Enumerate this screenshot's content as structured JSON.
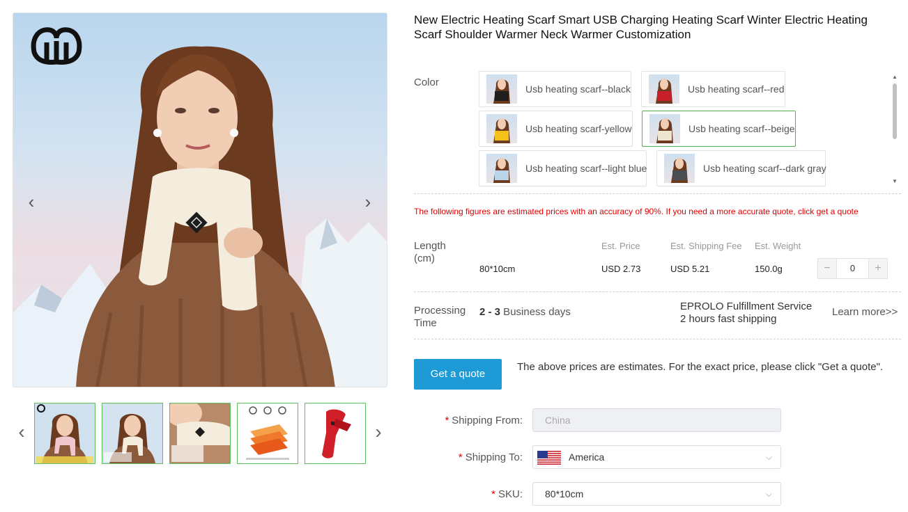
{
  "product": {
    "title": "New Electric Heating Scarf Smart USB Charging Heating Scarf Winter Electric Heating Scarf Shoulder Warmer Neck Warmer Customization"
  },
  "gallery": {
    "prev_arrow": "‹",
    "next_arrow": "›",
    "thumb_prev": "‹",
    "thumb_next": "›",
    "thumbnails": [
      {
        "icon": "thumbnail-model-pink-scarf"
      },
      {
        "icon": "thumbnail-model-beige-scarf"
      },
      {
        "icon": "thumbnail-scarf-closeup"
      },
      {
        "icon": "thumbnail-heating-zones-diagram"
      },
      {
        "icon": "thumbnail-red-scarf"
      }
    ]
  },
  "color": {
    "label": "Color",
    "options": [
      {
        "label": "Usb heating scarf--black",
        "swatch": "#1f1f1f",
        "selected": false
      },
      {
        "label": "Usb heating scarf--red",
        "swatch": "#c8202a",
        "selected": false
      },
      {
        "label": "Usb heating scarf-yellow",
        "swatch": "#f2c21b",
        "selected": false
      },
      {
        "label": "Usb heating scarf--beige",
        "swatch": "#efe6d2",
        "selected": true
      },
      {
        "label": "Usb heating scarf--light blue",
        "swatch": "#b9d5ea",
        "selected": false
      },
      {
        "label": "Usb heating scarf--dark gray",
        "swatch": "#4a4d52",
        "selected": false
      }
    ]
  },
  "notice": "The following figures are estimated prices with an accuracy of 90%. If you need a more accurate quote, click get a quote",
  "pricing": {
    "length_label": "Length (cm)",
    "headers": {
      "price": "Est. Price",
      "shipping": "Est. Shipping Fee",
      "weight": "Est. Weight"
    },
    "row": {
      "length": "80*10cm",
      "price": "USD 2.73",
      "shipping": "USD 5.21",
      "weight": "150.0g",
      "quantity": "0"
    },
    "minus": "−",
    "plus": "+"
  },
  "processing": {
    "label": "Processing Time",
    "days": "2 - 3",
    "days_suffix": " Business days",
    "service_line1": "EPROLO Fulfillment Service",
    "service_line2": "2 hours fast shipping",
    "learn_more": "Learn more>>"
  },
  "quote": {
    "button": "Get a quote",
    "note": "The above prices are estimates. For the exact price, please click \"Get a quote\"."
  },
  "form": {
    "required_mark": "*",
    "shipping_from": {
      "label": "Shipping From:",
      "value": "China"
    },
    "shipping_to": {
      "label": "Shipping To:",
      "value": "America",
      "flag_icon": "us-flag-icon"
    },
    "sku": {
      "label": "SKU:",
      "value": "80*10cm"
    },
    "chevron": "⌵"
  },
  "colors": {
    "accent": "#1e9ad6",
    "notice_red": "#e00000",
    "selected_border": "#4caf50"
  }
}
